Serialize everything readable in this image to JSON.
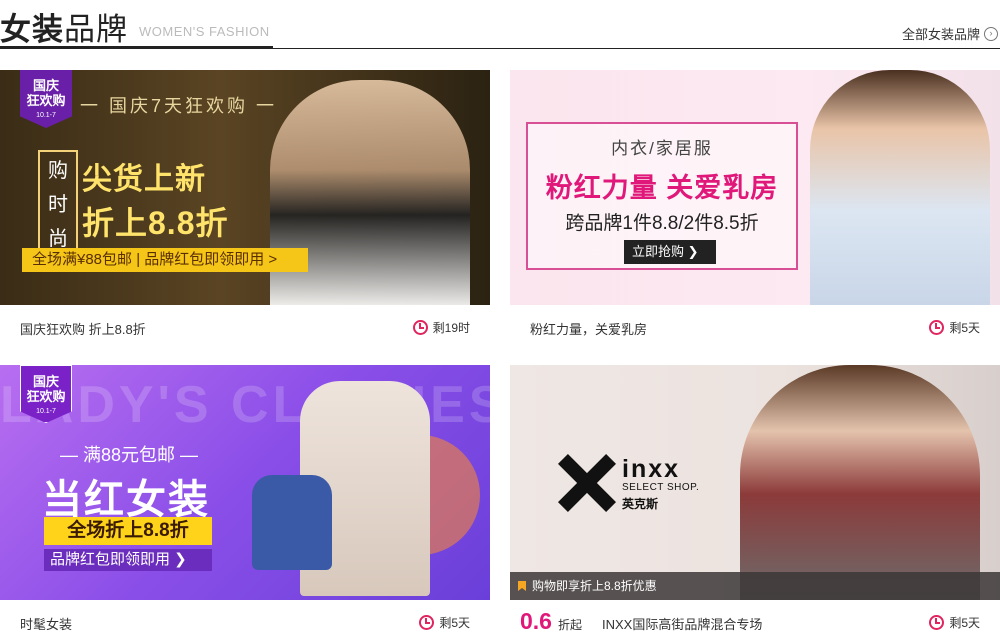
{
  "header": {
    "title_bold": "女装",
    "title_rest": "品牌",
    "subtitle": "WOMEN'S FASHION",
    "all_link": "全部女装品牌"
  },
  "cards": [
    {
      "banner": {
        "badge_top": "国庆",
        "badge_mid": "狂欢购",
        "badge_date": "10.1-7",
        "headline": "一 国庆7天狂欢购 一",
        "vertical": "购时尚",
        "line1": "尖货上新",
        "line2": "折上8.8折",
        "strip": "全场满¥88包邮 | 品牌红包即领即用 >"
      },
      "desc": "国庆狂欢购 折上8.8折",
      "remaining": "剩19时"
    },
    {
      "banner": {
        "top": "内衣/家居服",
        "big": "粉红力量 关爱乳房",
        "mid": "跨品牌1件8.8/2件8.5折",
        "button": "立即抢购 ❯"
      },
      "desc": "粉红力量，关爱乳房",
      "remaining": "剩5天"
    },
    {
      "banner": {
        "badge_top": "国庆",
        "badge_mid": "狂欢购",
        "badge_date": "10.1-7",
        "bg_text": "LADY'S CLOTHES",
        "promo": "— 满88元包邮 —",
        "big": "当红女装",
        "strip": "全场折上8.8折",
        "sub": "品牌红包即领即用 ❯"
      },
      "desc": "时髦女装",
      "remaining": "剩5天"
    },
    {
      "banner": {
        "brand": "inxx",
        "brand_sub": "SELECT SHOP.",
        "brand_cn": "英克斯",
        "notice": "购物即享折上8.8折优惠"
      },
      "price_num": "0.6",
      "price_unit": "折起",
      "desc": "INXX国际高街品牌混合专场",
      "remaining": "剩5天"
    }
  ],
  "colors": {
    "accent": "#e0187a",
    "clock": "#e0245e"
  }
}
